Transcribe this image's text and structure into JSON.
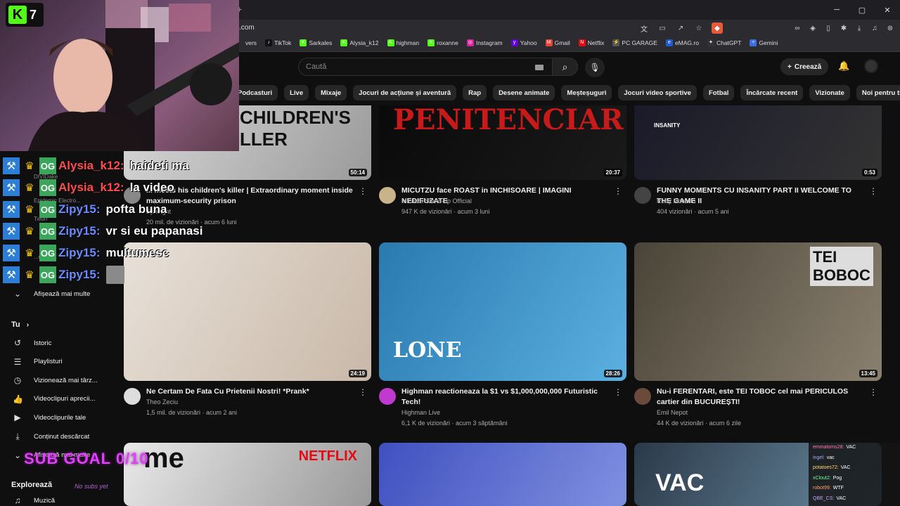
{
  "browser": {
    "url": ".com",
    "window_controls": [
      "─",
      "▢",
      "✕"
    ],
    "bookmarks": [
      {
        "label": "vers",
        "color": "#2b2b30",
        "icon": ""
      },
      {
        "label": "TikTok",
        "color": "#111111",
        "icon": "♪"
      },
      {
        "label": "Sarkales",
        "color": "#53fc18",
        "icon": "K"
      },
      {
        "label": "Alysia_k12",
        "color": "#53fc18",
        "icon": "K"
      },
      {
        "label": "highman",
        "color": "#53fc18",
        "icon": "K"
      },
      {
        "label": "roxanne",
        "color": "#53fc18",
        "icon": "K"
      },
      {
        "label": "Instagram",
        "color": "#d6249f",
        "icon": "◎"
      },
      {
        "label": "Yahoo",
        "color": "#6001d2",
        "icon": "y"
      },
      {
        "label": "Gmail",
        "color": "#ea4335",
        "icon": "M"
      },
      {
        "label": "Netflix",
        "color": "#e50914",
        "icon": "N"
      },
      {
        "label": "PC GARAGE",
        "color": "#555555",
        "icon": "⚡"
      },
      {
        "label": "eMAG.ro",
        "color": "#1e5bd8",
        "icon": "e"
      },
      {
        "label": "ChatGPT",
        "color": "#333333",
        "icon": "✦"
      },
      {
        "label": "Gemini",
        "color": "#3c6ee0",
        "icon": "✧"
      }
    ]
  },
  "header": {
    "search_placeholder": "Caută",
    "create_label": "Creează"
  },
  "chips": [
    "Podcasturi",
    "Live",
    "Mixaje",
    "Jocuri de acțiune și aventură",
    "Rap",
    "Desene animate",
    "Meșteșuguri",
    "Jocuri video sportive",
    "Fotbal",
    "Încărcate recent",
    "Vizionate",
    "Noi pentru tine"
  ],
  "videos": [
    {
      "title": "... meets his children's killer | Extraordinary moment inside maximum-security prison",
      "channel": "Spotlight",
      "meta": "20 mil. de vizionări · acum 6 luni",
      "duration": "50:14",
      "thumb_text": "CHILDREN'S\nLLER",
      "av_color": "#888888"
    },
    {
      "title": "MICUTZU face ROAST in INCHISOARE | IMAGINI NEDIFUZATE",
      "channel": "Micutzu Stand-up Official",
      "meta": "947 K de vizionări · acum 3 luni",
      "duration": "20:37",
      "thumb_text": "PENITENCIAR",
      "av_color": "#c9b48a"
    },
    {
      "title": "FUNNY MOMENTS CU INSANITY PART II WELCOME TO THE GAME II",
      "channel": "Roby Roberto",
      "meta": "404 vizionări · acum 5 ani",
      "duration": "0:53",
      "thumb_text": "INSANITY",
      "av_color": "#444444"
    },
    {
      "title": "Ne Certam De Fata Cu Prietenii Nostri! *Prank*",
      "channel": "Theo Zeciu",
      "meta": "1,5 mil. de vizionări · acum 2 ani",
      "duration": "24:19",
      "thumb_text": "",
      "av_color": "#dddddd"
    },
    {
      "title": "Highman reactioneaza la $1 vs $1,000,000,000 Futuristic Tech!",
      "channel": "Highman Live",
      "meta": "6,1 K de vizionări · acum 3 săptămâni",
      "duration": "28:26",
      "thumb_text": "LONE",
      "av_color": "#c03ad0"
    },
    {
      "title": "Nu-i FERENTARI, este TEI TOBOC cel mai PERICULOS cartier din BUCUREȘTI!",
      "channel": "Emil Nepot",
      "meta": "44 K de vizionări · acum 6 zile",
      "duration": "13:45",
      "thumb_text": "TEI\nBOBOC",
      "av_color": "#6a4a3a"
    },
    {
      "title": "",
      "channel": "",
      "meta": "",
      "duration": "",
      "thumb_text": "me",
      "badge": "NETFLIX"
    },
    {
      "title": "",
      "channel": "",
      "meta": "",
      "duration": "",
      "thumb_text": ""
    },
    {
      "title": "",
      "channel": "",
      "meta": "",
      "duration": "",
      "thumb_text": "VAC"
    }
  ],
  "sidebar": {
    "show_more_top": "Afișează mai multe",
    "section_you": "Tu",
    "items": [
      {
        "label": "Istoric",
        "icon": "↺"
      },
      {
        "label": "Playlisturi",
        "icon": "☰"
      },
      {
        "label": "Vizionează mai târz...",
        "icon": "◷"
      },
      {
        "label": "Videoclipuri aprecii...",
        "icon": "👍"
      },
      {
        "label": "Videoclipurile tale",
        "icon": "▶"
      },
      {
        "label": "Conținut descărcat",
        "icon": "⤓"
      },
      {
        "label": "Afișează mai multe",
        "icon": "⌄"
      }
    ],
    "section_explore": "Explorează",
    "explore_items": [
      {
        "label": "Muzică",
        "icon": "♫"
      }
    ],
    "behind_chat": [
      "DIVIDake",
      "Epidemic Electro...",
      "Twuri",
      "...ed"
    ]
  },
  "stream": {
    "logo_letter": "K",
    "logo_number": "7",
    "chat": [
      {
        "user": "Alysia_k12:",
        "msg": "haideti ma",
        "color": "#ff4d4d"
      },
      {
        "user": "Alysia_k12:",
        "msg": "la video",
        "color": "#ff4d4d"
      },
      {
        "user": "Zipy15:",
        "msg": "pofta buna",
        "color": "#6a8cff"
      },
      {
        "user": "Zipy15:",
        "msg": "vr si eu papanasi",
        "color": "#6a8cff"
      },
      {
        "user": "Zipy15:",
        "msg": "multumesc",
        "color": "#6a8cff"
      },
      {
        "user": "Zipy15:",
        "msg": "",
        "color": "#6a8cff"
      }
    ],
    "sub_goal": "SUB GOAL 0/10",
    "no_subs": "No subs yet",
    "mini_chat": [
      {
        "user": "emmatoms28:",
        "msg": "VAC",
        "color": "#ff7ab0"
      },
      {
        "user": "ingel:",
        "msg": "vac",
        "color": "#9ab0ff"
      },
      {
        "user": "potatoes72:",
        "msg": "VAC",
        "color": "#ffd86a"
      },
      {
        "user": "xClout2:",
        "msg": "Pog",
        "color": "#6aff9a"
      },
      {
        "user": "robot99:",
        "msg": "WTF",
        "color": "#ffa06a"
      },
      {
        "user": "QBE_CS:",
        "msg": "VAC",
        "color": "#c9a0ff"
      }
    ]
  }
}
